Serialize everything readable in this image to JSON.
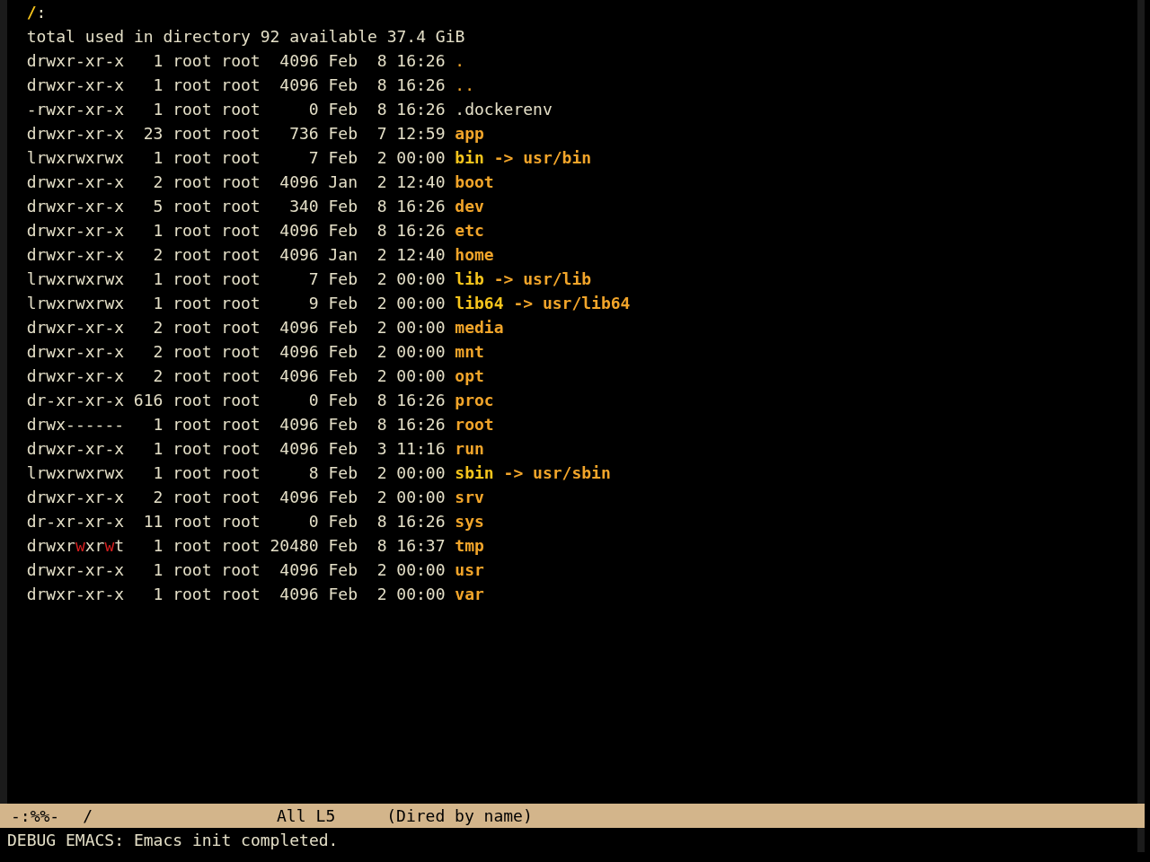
{
  "buffer": {
    "header": {
      "path": "/",
      "suffix": ":"
    },
    "summary": "total used in directory 92 available 37.4 GiB",
    "entries": [
      {
        "kind": "dot",
        "permissions": "drwxr-xr-x",
        "world_writable": false,
        "links": "1",
        "owner": "root",
        "group": "root",
        "size": "4096",
        "month": "Feb",
        "day": "8",
        "time": "16:26",
        "name": "."
      },
      {
        "kind": "dot",
        "permissions": "drwxr-xr-x",
        "world_writable": false,
        "links": "1",
        "owner": "root",
        "group": "root",
        "size": "4096",
        "month": "Feb",
        "day": "8",
        "time": "16:26",
        "name": ".."
      },
      {
        "kind": "file",
        "permissions": "-rwxr-xr-x",
        "world_writable": false,
        "links": "1",
        "owner": "root",
        "group": "root",
        "size": "0",
        "month": "Feb",
        "day": "8",
        "time": "16:26",
        "name": ".dockerenv"
      },
      {
        "kind": "dir",
        "permissions": "drwxr-xr-x",
        "world_writable": false,
        "links": "23",
        "owner": "root",
        "group": "root",
        "size": "736",
        "month": "Feb",
        "day": "7",
        "time": "12:59",
        "name": "app"
      },
      {
        "kind": "symlink",
        "permissions": "lrwxrwxrwx",
        "world_writable": false,
        "links": "1",
        "owner": "root",
        "group": "root",
        "size": "7",
        "month": "Feb",
        "day": "2",
        "time": "00:00",
        "name": "bin",
        "arrow": "->",
        "target": "usr/bin"
      },
      {
        "kind": "dir",
        "permissions": "drwxr-xr-x",
        "world_writable": false,
        "links": "2",
        "owner": "root",
        "group": "root",
        "size": "4096",
        "month": "Jan",
        "day": "2",
        "time": "12:40",
        "name": "boot"
      },
      {
        "kind": "dir",
        "permissions": "drwxr-xr-x",
        "world_writable": false,
        "links": "5",
        "owner": "root",
        "group": "root",
        "size": "340",
        "month": "Feb",
        "day": "8",
        "time": "16:26",
        "name": "dev"
      },
      {
        "kind": "dir",
        "permissions": "drwxr-xr-x",
        "world_writable": false,
        "links": "1",
        "owner": "root",
        "group": "root",
        "size": "4096",
        "month": "Feb",
        "day": "8",
        "time": "16:26",
        "name": "etc"
      },
      {
        "kind": "dir",
        "permissions": "drwxr-xr-x",
        "world_writable": false,
        "links": "2",
        "owner": "root",
        "group": "root",
        "size": "4096",
        "month": "Jan",
        "day": "2",
        "time": "12:40",
        "name": "home"
      },
      {
        "kind": "symlink",
        "permissions": "lrwxrwxrwx",
        "world_writable": false,
        "links": "1",
        "owner": "root",
        "group": "root",
        "size": "7",
        "month": "Feb",
        "day": "2",
        "time": "00:00",
        "name": "lib",
        "arrow": "->",
        "target": "usr/lib"
      },
      {
        "kind": "symlink",
        "permissions": "lrwxrwxrwx",
        "world_writable": false,
        "links": "1",
        "owner": "root",
        "group": "root",
        "size": "9",
        "month": "Feb",
        "day": "2",
        "time": "00:00",
        "name": "lib64",
        "arrow": "->",
        "target": "usr/lib64"
      },
      {
        "kind": "dir",
        "permissions": "drwxr-xr-x",
        "world_writable": false,
        "links": "2",
        "owner": "root",
        "group": "root",
        "size": "4096",
        "month": "Feb",
        "day": "2",
        "time": "00:00",
        "name": "media"
      },
      {
        "kind": "dir",
        "permissions": "drwxr-xr-x",
        "world_writable": false,
        "links": "2",
        "owner": "root",
        "group": "root",
        "size": "4096",
        "month": "Feb",
        "day": "2",
        "time": "00:00",
        "name": "mnt"
      },
      {
        "kind": "dir",
        "permissions": "drwxr-xr-x",
        "world_writable": false,
        "links": "2",
        "owner": "root",
        "group": "root",
        "size": "4096",
        "month": "Feb",
        "day": "2",
        "time": "00:00",
        "name": "opt"
      },
      {
        "kind": "dir",
        "permissions": "dr-xr-xr-x",
        "world_writable": false,
        "links": "616",
        "owner": "root",
        "group": "root",
        "size": "0",
        "month": "Feb",
        "day": "8",
        "time": "16:26",
        "name": "proc"
      },
      {
        "kind": "dir",
        "permissions": "drwx------",
        "world_writable": false,
        "links": "1",
        "owner": "root",
        "group": "root",
        "size": "4096",
        "month": "Feb",
        "day": "8",
        "time": "16:26",
        "name": "root"
      },
      {
        "kind": "dir",
        "permissions": "drwxr-xr-x",
        "world_writable": false,
        "links": "1",
        "owner": "root",
        "group": "root",
        "size": "4096",
        "month": "Feb",
        "day": "3",
        "time": "11:16",
        "name": "run"
      },
      {
        "kind": "symlink",
        "permissions": "lrwxrwxrwx",
        "world_writable": false,
        "links": "1",
        "owner": "root",
        "group": "root",
        "size": "8",
        "month": "Feb",
        "day": "2",
        "time": "00:00",
        "name": "sbin",
        "arrow": "->",
        "target": "usr/sbin"
      },
      {
        "kind": "dir",
        "permissions": "drwxr-xr-x",
        "world_writable": false,
        "links": "2",
        "owner": "root",
        "group": "root",
        "size": "4096",
        "month": "Feb",
        "day": "2",
        "time": "00:00",
        "name": "srv"
      },
      {
        "kind": "dir",
        "permissions": "dr-xr-xr-x",
        "world_writable": false,
        "links": "11",
        "owner": "root",
        "group": "root",
        "size": "0",
        "month": "Feb",
        "day": "8",
        "time": "16:26",
        "name": "sys"
      },
      {
        "kind": "dir",
        "permissions": "drwxrwxrwt",
        "world_writable": true,
        "links": "1",
        "owner": "root",
        "group": "root",
        "size": "20480",
        "month": "Feb",
        "day": "8",
        "time": "16:37",
        "name": "tmp"
      },
      {
        "kind": "dir",
        "permissions": "drwxr-xr-x",
        "world_writable": false,
        "links": "1",
        "owner": "root",
        "group": "root",
        "size": "4096",
        "month": "Feb",
        "day": "2",
        "time": "00:00",
        "name": "usr"
      },
      {
        "kind": "dir",
        "permissions": "drwxr-xr-x",
        "world_writable": false,
        "links": "1",
        "owner": "root",
        "group": "root",
        "size": "4096",
        "month": "Feb",
        "day": "2",
        "time": "00:00",
        "name": "var"
      }
    ]
  },
  "mode_line": {
    "status": "-:%%-",
    "buffer_name": "/",
    "scroll": "All",
    "line": "L5",
    "mode": "(Dired by name)"
  },
  "echo_area": "DEBUG EMACS: Emacs init completed."
}
